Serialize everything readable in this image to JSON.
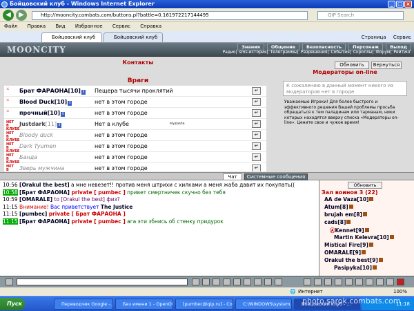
{
  "window": {
    "title": "Бойцовский клуб - Windows Internet Explorer",
    "url": "http://mooncity.combats.com/buttons.pl?battle=0.161972217144495",
    "search_placeholder": "QIP Search"
  },
  "menu": [
    "Файл",
    "Правка",
    "Вид",
    "Избранное",
    "Сервис",
    "Справка"
  ],
  "tabs": [
    "Бойцовский клуб",
    "Бойцовский клуб"
  ],
  "tabtools": [
    "Страница",
    "Сервис"
  ],
  "game": {
    "logo": "MOONCITY",
    "nav_main": [
      "Знания",
      "Общение",
      "Безопасность",
      "Персонаж",
      "Выход"
    ],
    "nav_sub": [
      "Радио",
      "sms-история",
      "Телеграммы",
      "Разрешения",
      "События",
      "Скроллы",
      "Форум",
      "Рейтинг"
    ]
  },
  "contacts": {
    "title": "Контакты",
    "enemies_title": "Враги",
    "refresh": "Обновить",
    "back": "Вернуться"
  },
  "enemies": [
    {
      "name": "Брат ФАРАОНА",
      "level": "[10]",
      "status": "Пещера тысячи проклятий",
      "online": true,
      "note": ""
    },
    {
      "name": "Blood Duck",
      "level": "[10]",
      "status": "нет в этом городе",
      "online": true,
      "note": ""
    },
    {
      "name": "прочный",
      "level": "[10]",
      "status": "нет в этом городе",
      "online": true,
      "note": ""
    },
    {
      "name": "Justdark",
      "level": "[11]",
      "status": "Нет в клубе",
      "online": false,
      "note": "мудила"
    },
    {
      "name": "Bloody duck",
      "level": "",
      "status": "нет в этом городе",
      "online": false,
      "note": ""
    },
    {
      "name": "Dark Tyumen",
      "level": "",
      "status": "нет в этом городе",
      "online": false,
      "note": ""
    },
    {
      "name": "Банда",
      "level": "",
      "status": "нет в этом городе",
      "online": false,
      "note": ""
    },
    {
      "name": "Зверь мужчина",
      "level": "",
      "status": "нет в этом городе",
      "online": false,
      "note": ""
    }
  ],
  "mods": {
    "title": "Модераторы on-line",
    "empty": "К сожалению в данный момент никого из модераторов нет в городе.",
    "info": "Уважаемые Игроки! Для более быстрого и эффективного решения Вашей проблемы просьба обращаться к тем паладинам или тарманам, ники которых находятся вверху списка «Модераторы on-line». Цените свое и чужое время!"
  },
  "chat": {
    "tabs": [
      "Чат",
      "Системные сообщения"
    ],
    "lines": [
      {
        "time": "10:56",
        "user": "[Orakul the best]",
        "text": "а мне невезет!! против меня штрихи с хилками а меня жаба давит их покупать(("
      },
      {
        "time": "10:58",
        "user": "[Брат ФАРАОНА]",
        "private": "private [ pumbec ]",
        "text": "привет смертничек скучно без тебя"
      },
      {
        "time": "10:59",
        "user": "[OMARALE]",
        "private": "to [Orakul the best]",
        "text": "физ?"
      },
      {
        "time": "11:15",
        "user": "",
        "attention": "Внимание!",
        "text": "Вас приветствует",
        "extra": "The Justice"
      },
      {
        "time": "11:15",
        "user": "[pumbec]",
        "private": "private [ Брат ФАРАОНА ]",
        "text": ""
      },
      {
        "time": "11:15",
        "user": "[Брат ФАРАОНА]",
        "private": "private [ pumbec ]",
        "text": "ага эти збнись об стенку придурок"
      }
    ]
  },
  "room": {
    "refresh": "Обновить",
    "title": "Зал воинов 3 (22)",
    "users": [
      "AA de Vaza[10]",
      "Atum[8]",
      "brujah em[8]",
      "cads[8]",
      "Kennet[9]",
      "Martin Kelevra[10]",
      "Mistical Fire[9]",
      "OMARALE[9]",
      "Orakul the best[9]",
      "Pasipyka[10]"
    ]
  },
  "status": {
    "internet": "Интернет",
    "zoom": "100%"
  },
  "taskbar": {
    "start": "Пуск",
    "items": [
      "Переводчик Google -...",
      "Без имени 1 - OpenOf...",
      "[pumbec@qip.ru] - Сооб...",
      "C:\\WINDOWS\\system...",
      "Бойцовский клуб - ..."
    ],
    "clock": "11:18"
  },
  "watermark": "photo.sarok.combats.com"
}
